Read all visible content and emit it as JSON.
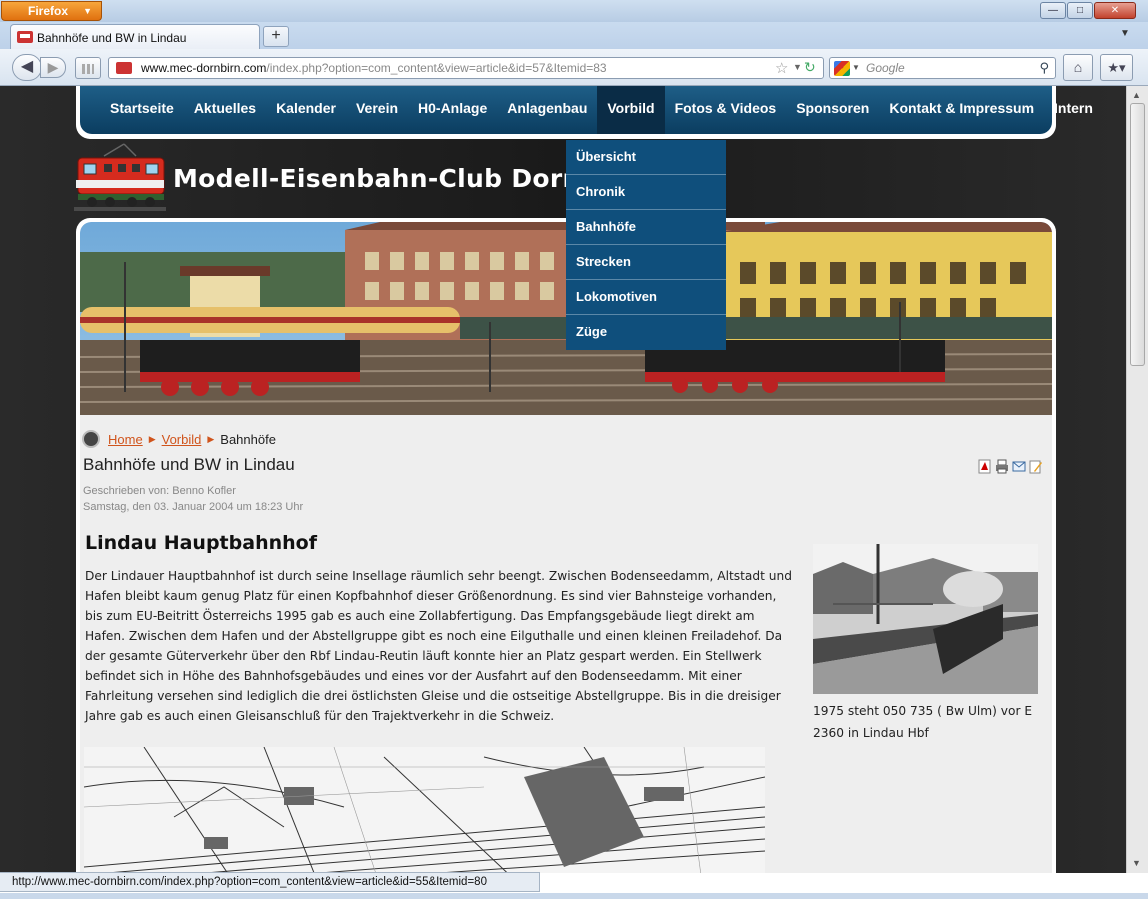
{
  "browser": {
    "app_button": "Firefox",
    "tab_title": "Bahnhöfe und BW in Lindau",
    "new_tab": "+",
    "url_host": "www.mec-dornbirn.com",
    "url_path": "/index.php?option=com_content&view=article&id=57&Itemid=83",
    "search_placeholder": "Google",
    "status_url": "http://www.mec-dornbirn.com/index.php?option=com_content&view=article&id=55&Itemid=80"
  },
  "site": {
    "title": "Modell-Eisenbahn-Club Dornbirn",
    "menu": [
      "Startseite",
      "Aktuelles",
      "Kalender",
      "Verein",
      "H0-Anlage",
      "Anlagenbau",
      "Vorbild",
      "Fotos & Videos",
      "Sponsoren",
      "Kontakt & Impressum",
      "Intern"
    ],
    "active_menu": "Vorbild",
    "dropdown": [
      "Übersicht",
      "Chronik",
      "Bahnhöfe",
      "Strecken",
      "Lokomotiven",
      "Züge"
    ]
  },
  "breadcrumb": {
    "home": "Home",
    "section": "Vorbild",
    "current": "Bahnhöfe"
  },
  "article": {
    "title": "Bahnhöfe und BW in Lindau",
    "author": "Geschrieben von: Benno Kofler",
    "date": "Samstag, den 03. Januar 2004 um 18:23 Uhr",
    "heading": "Lindau Hauptbahnhof",
    "text": "Der Lindauer Hauptbahnhof ist durch seine Insellage räumlich sehr beengt. Zwischen Bodenseedamm, Altstadt und Hafen bleibt kaum genug Platz für einen Kopfbahnhof dieser Größenordnung. Es sind vier Bahnsteige vorhanden, bis zum EU-Beitritt Österreichs 1995 gab es auch eine Zollabfertigung. Das Empfangsgebäude liegt direkt am Hafen. Zwischen dem Hafen und der Abstellgruppe gibt es noch eine Eilguthalle und einen kleinen Freiladehof. Da der gesamte Güterverkehr über den Rbf Lindau-Reutin läuft konnte hier an Platz gespart werden. Ein Stellwerk befindet sich in Höhe des Bahnhofsgebäudes und eines vor der Ausfahrt auf den Bodenseedamm. Mit einer Fahrleitung versehen sind lediglich die drei östlichsten Gleise und die ostseitige Abstellgruppe. Bis in die dreisiger Jahre gab es auch einen Gleisanschluß für den Trajektverkehr in die Schweiz.",
    "photo_caption": "1975 steht 050 735 ( Bw Ulm) vor E 2360 in Lindau Hbf"
  }
}
